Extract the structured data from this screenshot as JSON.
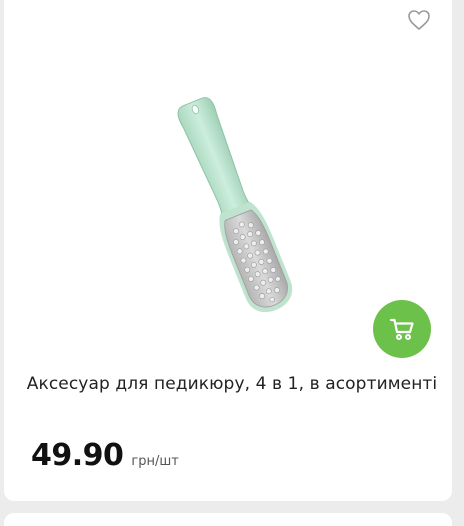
{
  "product": {
    "title": "Аксесуар для педикюру, 4 в 1, в асортименті",
    "price": "49.90",
    "unit": "грн/шт",
    "image": "pedicure-file-icon"
  },
  "actions": {
    "favorite_icon": "heart-outline-icon",
    "add_to_cart_icon": "cart-icon"
  },
  "colors": {
    "cart_button": "#6cc14a",
    "handle": "#bfe3cf",
    "grater": "#c8c8c8"
  }
}
